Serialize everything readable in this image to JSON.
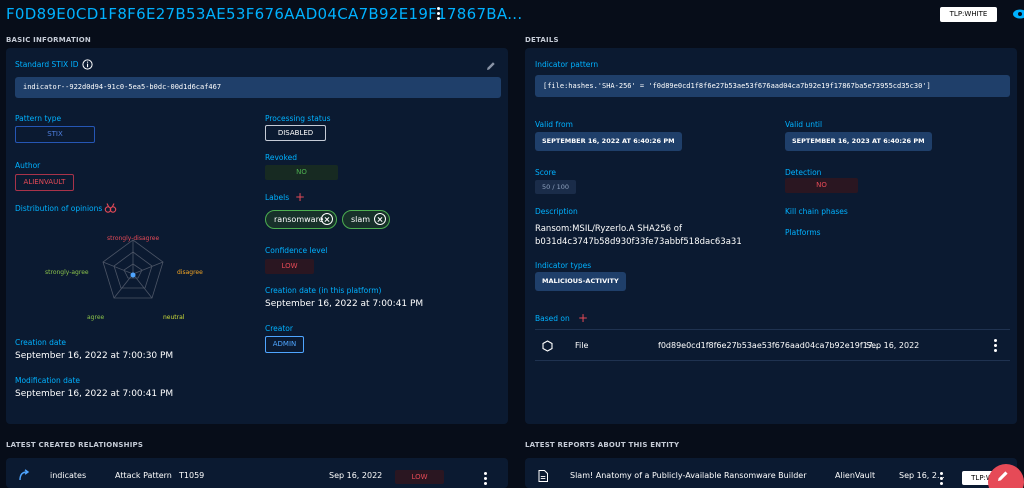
{
  "header": {
    "title": "F0D89E0CD1F8F6E27B53AE53F676AAD04CA7B92E19F17867BA...",
    "tlp": "TLP:WHITE"
  },
  "basic": {
    "section_title": "BASIC INFORMATION",
    "stix_label": "Standard STIX ID",
    "stix_id": "indicator--922d0d94-91c0-5ea5-b0dc-00d1d6caf467",
    "pattern_type_label": "Pattern type",
    "pattern_type": "STIX",
    "author_label": "Author",
    "author": "ALIENVAULT",
    "opinions_label": "Distribution of opinions",
    "radar_labels": {
      "top": "strongly-disagree",
      "right": "disagree",
      "bottom_right": "neutral",
      "bottom_left": "agree",
      "left": "strongly-agree"
    },
    "creation_date_label": "Creation date",
    "creation_date": "September 16, 2022 at 7:00:30 PM",
    "modification_date_label": "Modification date",
    "modification_date": "September 16, 2022 at 7:00:41 PM",
    "processing_status_label": "Processing status",
    "processing_status": "DISABLED",
    "revoked_label": "Revoked",
    "revoked": "NO",
    "labels_label": "Labels",
    "labels": [
      "ransomware",
      "slam"
    ],
    "confidence_label": "Confidence level",
    "confidence": "LOW",
    "platform_creation_label": "Creation date (in this platform)",
    "platform_creation": "September 16, 2022 at 7:00:41 PM",
    "creator_label": "Creator",
    "creator": "ADMIN"
  },
  "details": {
    "section_title": "DETAILS",
    "pattern_label": "Indicator pattern",
    "pattern": "[file:hashes.'SHA-256' = 'f0d89e0cd1f8f6e27b53ae53f676aad04ca7b92e19f17867ba5e73955cd35c30']",
    "valid_from_label": "Valid from",
    "valid_from": "SEPTEMBER 16, 2022 AT 6:40:26 PM",
    "valid_until_label": "Valid until",
    "valid_until": "SEPTEMBER 16, 2023 AT 6:40:26 PM",
    "score_label": "Score",
    "score": "50 / 100",
    "detection_label": "Detection",
    "detection": "NO",
    "description_label": "Description",
    "description_line1": "Ransom:MSIL/Ryzerlo.A SHA256 of",
    "description_line2": "b031d4c3747b58d930f33fe73abbf518dac63a31",
    "kill_chain_label": "Kill chain phases",
    "platforms_label": "Platforms",
    "types_label": "Indicator types",
    "types": "MALICIOUS-ACTIVITY",
    "based_on_label": "Based on",
    "based_on": {
      "type": "File",
      "value": "f0d89e0cd1f8f6e27b53ae53f676aad04ca7b92e19f17...",
      "date": "Sep 16, 2022"
    }
  },
  "relationships": {
    "section_title": "LATEST CREATED RELATIONSHIPS",
    "row": {
      "type": "indicates",
      "entity_type": "Attack Pattern",
      "name": "T1059",
      "date": "Sep 16, 2022",
      "confidence": "LOW"
    }
  },
  "reports": {
    "section_title": "LATEST REPORTS ABOUT THIS ENTITY",
    "row": {
      "title": "Slam! Anatomy of a Publicly-Available Ransomware Builder",
      "author": "AlienVault",
      "date": "Sep 16, 2...",
      "tlp": "TLP:WHITE"
    }
  },
  "colors": {
    "accent": "#00b1ff",
    "background": "#070d19",
    "panel": "#0b1a31",
    "red": "#e64a57",
    "green": "#4caf50"
  }
}
